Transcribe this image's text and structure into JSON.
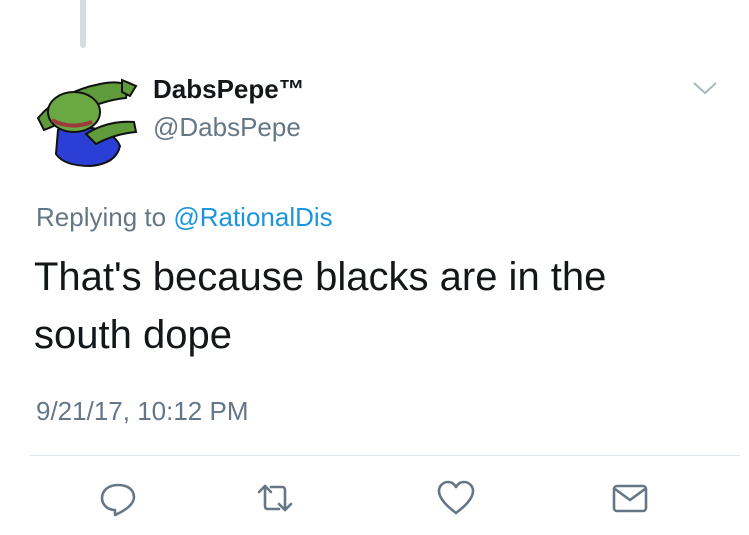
{
  "tweet": {
    "display_name": "DabsPepe™",
    "handle": "@DabsPepe",
    "replying_prefix": "Replying to ",
    "replying_to": "@RationalDis",
    "text": "That's because blacks are in the south dope",
    "timestamp": "9/21/17, 10:12 PM"
  },
  "icons": {
    "menu": "chevron-down-icon",
    "reply": "reply-icon",
    "retweet": "retweet-icon",
    "like": "heart-icon",
    "dm": "envelope-icon"
  },
  "colors": {
    "text": "#14171a",
    "secondary": "#657786",
    "link": "#1b95e0",
    "divider": "#e1e8ed"
  }
}
